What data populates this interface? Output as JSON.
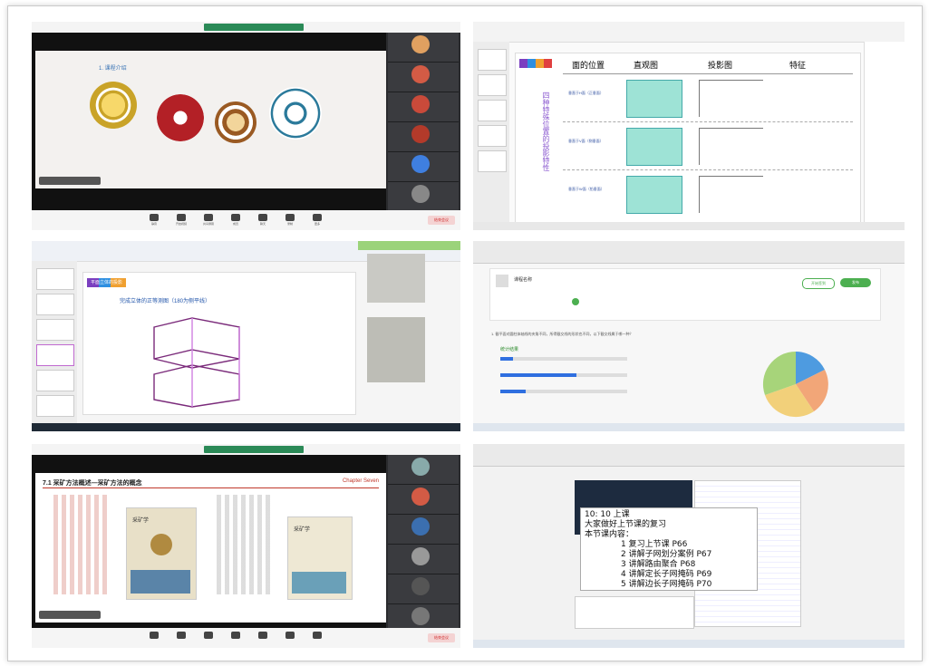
{
  "colors": {
    "meeting_green": "#2b8a57",
    "accent_blue": "#2f6fb5",
    "end_red": "#d03030",
    "pie": [
      "#4e9be0",
      "#a7d47a",
      "#f2a678",
      "#f2d07a"
    ]
  },
  "shot1": {
    "slide_heading": "1. 课程介绍",
    "seals": [
      "school-seal-1",
      "school-seal-2",
      "school-seal-3",
      "school-seal-4"
    ],
    "toolbar": [
      "静音",
      "开启视频",
      "共享屏幕",
      "成员",
      "聊天",
      "录制",
      "更多"
    ],
    "end_label": "结束会议"
  },
  "shot2": {
    "side_title": "四种特殊位置的投影特性",
    "headers": [
      "面的位置",
      "直观图",
      "投影图",
      "特征"
    ],
    "rows": [
      "垂直于H面（正垂面）",
      "垂直于V面（侧垂面）",
      "垂直于W面（铅垂面）"
    ]
  },
  "shot3": {
    "slide_title": "平面立体的投影",
    "caption": "完成立体的正等测图（180为侧平线）"
  },
  "shot4": {
    "course": "课程名称",
    "btn_a": "开始签到",
    "btn_b": "发布",
    "question": "1. 截平面对圆柱体轴线的夹角不同，所得截交线的形状也不同，以下截交线属于哪一种？",
    "stats_label": "统计结果"
  },
  "shot5": {
    "chapter": "7.1 采矿方法概述—采矿方法的概念",
    "chapter_en": "Chapter Seven",
    "book1": "采矿学",
    "book2": "采矿学"
  },
  "shot6": {
    "lesson": [
      "10: 10 上课",
      "大家做好上节课的复习",
      "本节课内容：",
      "1 复习上节课         P66",
      "2 讲解子网划分案例   P67",
      "3 讲解路由聚合       P68",
      "4 讲解定长子网掩码   P69",
      "5 讲解边长子网掩码   P70"
    ]
  }
}
